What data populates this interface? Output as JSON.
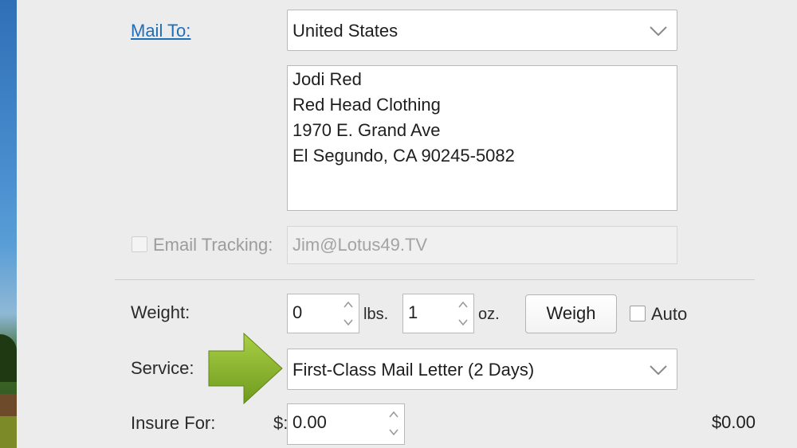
{
  "mail_to": {
    "label": "Mail To:",
    "country": "United States",
    "address_lines": [
      "Jodi Red",
      "Red Head Clothing",
      "1970 E. Grand Ave",
      "El Segundo, CA 90245-5082"
    ]
  },
  "email_tracking": {
    "label": "Email Tracking:",
    "value": "Jim@Lotus49.TV",
    "checked": false,
    "enabled": false
  },
  "weight": {
    "label": "Weight:",
    "lbs_value": "0",
    "lbs_unit": "lbs.",
    "oz_value": "1",
    "oz_unit": "oz.",
    "weigh_button": "Weigh",
    "auto_label": "Auto",
    "auto_checked": false
  },
  "service": {
    "label": "Service:",
    "value": "First-Class Mail Letter (2 Days)"
  },
  "insure": {
    "label": "Insure For:",
    "currency": "$:",
    "value": "0.00",
    "cost": "$0.00"
  },
  "colors": {
    "link": "#1f6fb8",
    "pointer_arrow": "#8dbb2f"
  },
  "icons": [
    "chevron-down-icon",
    "stepper-arrows-icon",
    "pointer-arrow-icon"
  ]
}
